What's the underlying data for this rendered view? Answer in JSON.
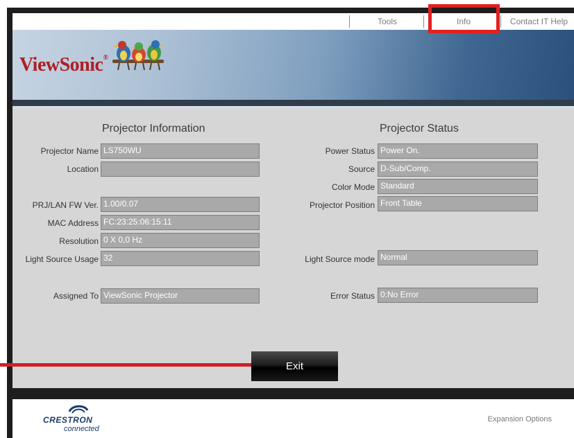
{
  "nav": {
    "tools": "Tools",
    "info": "Info",
    "contact": "Contact IT Help"
  },
  "brand": {
    "name": "ViewSonic",
    "tm": "®"
  },
  "info_section": {
    "title": "Projector Information",
    "projector_name": {
      "label": "Projector Name",
      "value": "LS750WU"
    },
    "location": {
      "label": "Location",
      "value": ""
    },
    "fw_ver": {
      "label": "PRJ/LAN FW Ver.",
      "value": "1.00/0.07"
    },
    "mac": {
      "label": "MAC Address",
      "value": "FC:23:25:06:15:11"
    },
    "resolution": {
      "label": "Resolution",
      "value": "0 X 0,0 Hz"
    },
    "light_usage": {
      "label": "Light Source Usage",
      "value": "32"
    },
    "assigned_to": {
      "label": "Assigned To",
      "value": "ViewSonic Projector"
    }
  },
  "status_section": {
    "title": "Projector Status",
    "power": {
      "label": "Power Status",
      "value": "Power On."
    },
    "source": {
      "label": "Source",
      "value": "D-Sub/Comp."
    },
    "color_mode": {
      "label": "Color Mode",
      "value": "Standard"
    },
    "position": {
      "label": "Projector Position",
      "value": "Front Table"
    },
    "light_mode": {
      "label": "Light Source mode",
      "value": "Normal"
    },
    "error": {
      "label": "Error Status",
      "value": "0:No Error"
    }
  },
  "exit_label": "Exit",
  "footer": {
    "crestron": "CRESTRON",
    "connected": "connected",
    "expansion": "Expansion Options"
  },
  "colors": {
    "highlight": "#e3201f",
    "brand_red": "#b01d24",
    "panel": "#d6d6d6",
    "field": "#a9a9a9"
  }
}
